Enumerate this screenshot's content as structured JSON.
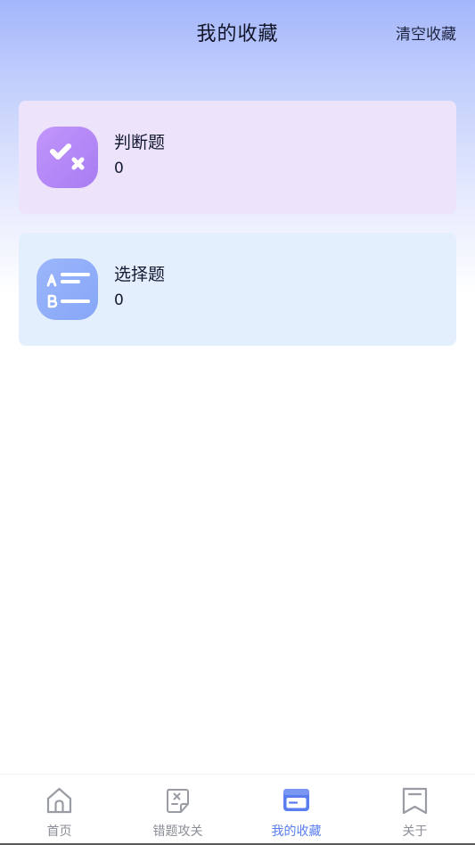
{
  "header": {
    "title": "我的收藏",
    "clear_label": "清空收藏"
  },
  "cards": [
    {
      "name": "判断题",
      "count": "0",
      "icon": "check-cross-icon"
    },
    {
      "name": "选择题",
      "count": "0",
      "icon": "ab-choice-icon"
    }
  ],
  "tabbar": {
    "items": [
      {
        "label": "首页",
        "icon": "home-icon",
        "active": false
      },
      {
        "label": "错题攻关",
        "icon": "wrong-questions-icon",
        "active": false
      },
      {
        "label": "我的收藏",
        "icon": "favorites-card-icon",
        "active": true
      },
      {
        "label": "关于",
        "icon": "bookmark-icon",
        "active": false
      }
    ]
  },
  "colors": {
    "accent": "#5a7ef0",
    "judge_card_bg": "#ede4fc",
    "choice_card_bg": "#e4effd",
    "judge_icon": "#b28af6",
    "choice_icon": "#91aef9",
    "tab_inactive": "#8a8d96"
  }
}
